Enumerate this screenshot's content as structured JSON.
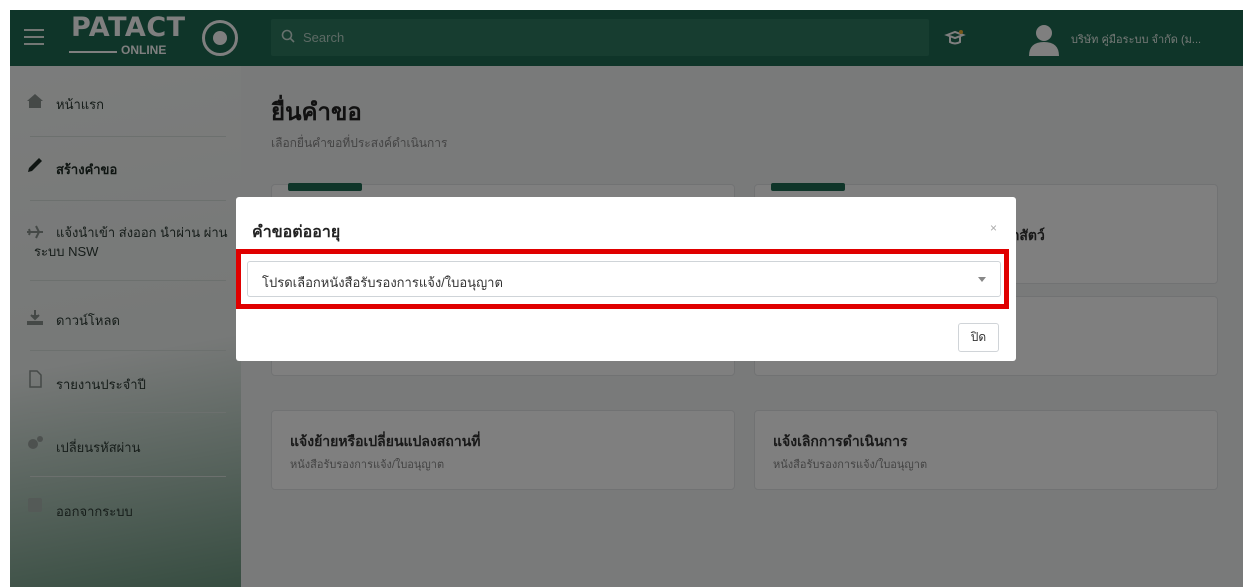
{
  "header": {
    "logo_text": "PATACT",
    "logo_sub": "ONLINE",
    "search_placeholder": "Search",
    "username": "บริษัท คู่มือระบบ จำกัด (ม..."
  },
  "sidebar": {
    "items": [
      {
        "label": "หน้าแรก",
        "icon": "home-icon"
      },
      {
        "label": "สร้างคำขอ",
        "icon": "pencil-icon"
      },
      {
        "label": "แจ้งนำเข้า ส่งออก นำผ่าน ผ่านระบบ NSW",
        "icon": "plane-icon"
      },
      {
        "label": "ดาวน์โหลด",
        "icon": "download-icon"
      },
      {
        "label": "รายงานประจำปี",
        "icon": "document-icon"
      },
      {
        "label": "เปลี่ยนรหัสผ่าน",
        "icon": "gears-icon"
      },
      {
        "label": "ออกจากระบบ",
        "icon": "logout-icon"
      }
    ]
  },
  "main": {
    "title": "ยื่นคำขอ",
    "subtitle": "เลือกยื่นคำขอที่ประสงค์ดำเนินการ",
    "cards": [
      {
        "title": "แจ้งย้ายหรือเปลี่ยนแปลงสถานที่",
        "subtitle": "หนังสือรับรองการแจ้ง/ใบอนุญาต"
      },
      {
        "title": "แจ้งเลิกการดำเนินการ",
        "subtitle": "หนังสือรับรองการแจ้ง/ใบอนุญาต"
      }
    ],
    "card_peek": "ากสัตว์"
  },
  "modal": {
    "title": "คำขอต่ออายุ",
    "close_x": "×",
    "select_value": "โปรดเลือกหนังสือรับรองการแจ้ง/ใบอนุญาต",
    "close_button": "ปิด"
  },
  "colors": {
    "brand": "#1f6b52",
    "highlight": "#e00000"
  }
}
